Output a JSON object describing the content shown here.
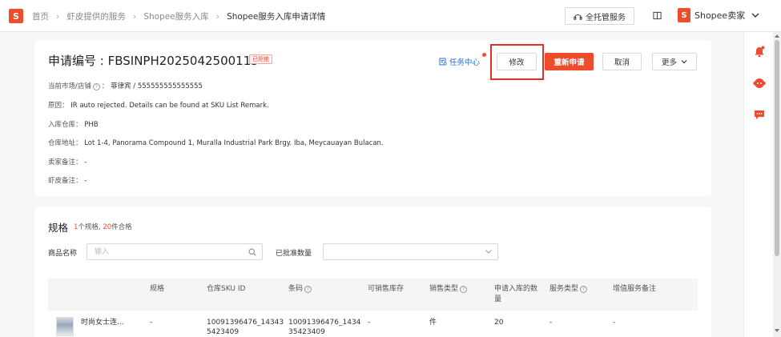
{
  "header": {
    "logo_letter": "S",
    "breadcrumb": [
      "首页",
      "虾皮提供的服务",
      "Shopee服务入库",
      "Shopee服务入库申请详情"
    ],
    "hosting_button": "全托管服务",
    "seller_label": "Shopee卖家",
    "seller_logo_letter": "S"
  },
  "detail": {
    "title": "申请编号 : FBSINPH2025042500113",
    "status_badge": "已拒绝",
    "market_label": "当前市场/店铺",
    "market_value": "菲律宾 / 555555555555555",
    "reason_label": "原因：",
    "reason_value": "IR auto rejected. Details can be found at SKU List Remark.",
    "warehouse_label": "入库仓库：",
    "warehouse_value": "PHB",
    "address_label": "仓库地址：",
    "address_value": "Lot 1-4, Panorama Compound 1, Muralla Industrial Park Brgy. Iba, Meycauayan Bulacan.",
    "seller_note_label": "卖家备注：",
    "seller_note_value": "-",
    "shopee_note_label": "虾皮备注：",
    "shopee_note_value": "-"
  },
  "actions": {
    "task_center": "任务中心",
    "modify": "修改",
    "reapply": "重新申请",
    "cancel": "取消",
    "more": "更多"
  },
  "spec": {
    "title": "规格",
    "count_sku": "1",
    "count_sku_text": "个规格,",
    "count_qty": "20",
    "count_qty_text": "件合格",
    "filter_name_label": "商品名称",
    "filter_name_placeholder": "输入",
    "filter_approved_label": "已批准数量",
    "filter_approved_value": ""
  },
  "table": {
    "headers": {
      "spec": "规格",
      "warehouse_sku": "仓库SKU ID",
      "barcode": "条码",
      "sellable_stock": "可销售库存",
      "sales_type": "销售类型",
      "inbound_qty_line1": "申请入库的数",
      "inbound_qty_line2": "量",
      "service_type": "服务类型",
      "vas_note": "增值服务备注"
    },
    "rows": [
      {
        "product_name": "时尚女士连...",
        "spec": "-",
        "warehouse_sku_line1": "10091396476_14343",
        "warehouse_sku_line2": "5423409",
        "barcode_line1": "10091396476_1434",
        "barcode_line2": "35423409",
        "sellable_stock": "-",
        "sales_type": "件",
        "inbound_qty": "20",
        "service_type": "-",
        "vas_note": "-"
      }
    ]
  },
  "colors": {
    "brand": "#ee4d2d",
    "link": "#2673dd",
    "highlight_box": "#e0302a"
  },
  "rail_icons": [
    "bell-icon",
    "support-bot-icon",
    "chat-icon"
  ]
}
